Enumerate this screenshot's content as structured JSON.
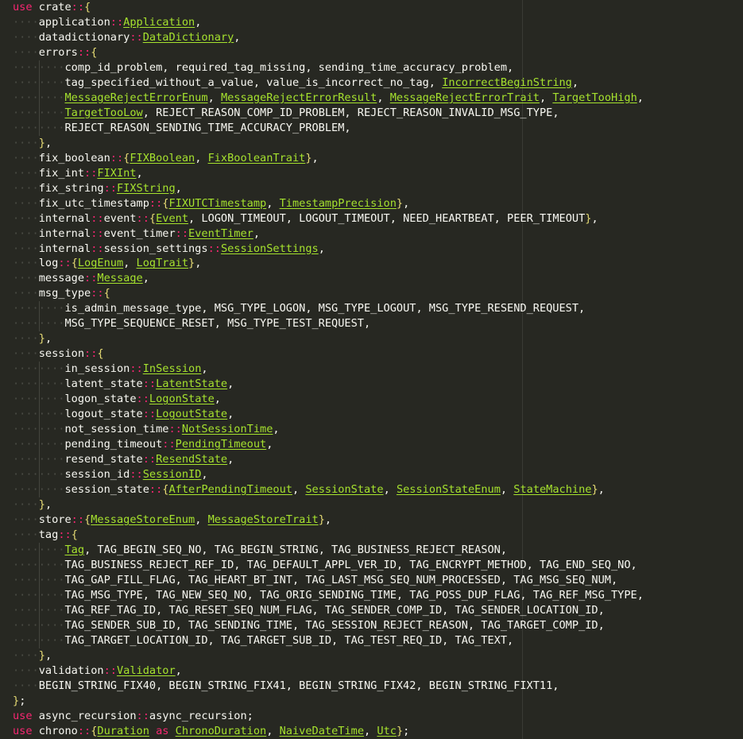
{
  "editor": {
    "language": "rust",
    "theme": "monokai",
    "colors": {
      "background": "#272822",
      "text": "#f8f8f2",
      "keyword": "#f92672",
      "type": "#a6e22e",
      "brace": "#e6db74",
      "whitespace": "#4b4c45"
    }
  },
  "lines": [
    {
      "indent": 0,
      "tokens": [
        {
          "t": "kw",
          "v": "use"
        },
        {
          "t": "tx",
          "v": " crate"
        },
        {
          "t": "op",
          "v": "::"
        },
        {
          "t": "br",
          "v": "{"
        }
      ]
    },
    {
      "indent": 1,
      "tokens": [
        {
          "t": "tx",
          "v": "application"
        },
        {
          "t": "op",
          "v": "::"
        },
        {
          "t": "ty",
          "v": "Application"
        },
        {
          "t": "tx",
          "v": ","
        }
      ]
    },
    {
      "indent": 1,
      "tokens": [
        {
          "t": "tx",
          "v": "datadictionary"
        },
        {
          "t": "op",
          "v": "::"
        },
        {
          "t": "ty",
          "v": "DataDictionary"
        },
        {
          "t": "tx",
          "v": ","
        }
      ]
    },
    {
      "indent": 1,
      "tokens": [
        {
          "t": "tx",
          "v": "errors"
        },
        {
          "t": "op",
          "v": "::"
        },
        {
          "t": "br",
          "v": "{"
        }
      ]
    },
    {
      "indent": 2,
      "tokens": [
        {
          "t": "tx",
          "v": "comp_id_problem, required_tag_missing, sending_time_accuracy_problem,"
        }
      ]
    },
    {
      "indent": 2,
      "tokens": [
        {
          "t": "tx",
          "v": "tag_specified_without_a_value, value_is_incorrect_no_tag, "
        },
        {
          "t": "ty",
          "v": "IncorrectBeginString"
        },
        {
          "t": "tx",
          "v": ","
        }
      ]
    },
    {
      "indent": 2,
      "tokens": [
        {
          "t": "ty",
          "v": "MessageRejectErrorEnum"
        },
        {
          "t": "tx",
          "v": ", "
        },
        {
          "t": "ty",
          "v": "MessageRejectErrorResult"
        },
        {
          "t": "tx",
          "v": ", "
        },
        {
          "t": "ty",
          "v": "MessageRejectErrorTrait"
        },
        {
          "t": "tx",
          "v": ", "
        },
        {
          "t": "ty",
          "v": "TargetTooHigh"
        },
        {
          "t": "tx",
          "v": ","
        }
      ]
    },
    {
      "indent": 2,
      "tokens": [
        {
          "t": "ty",
          "v": "TargetTooLow"
        },
        {
          "t": "tx",
          "v": ", REJECT_REASON_COMP_ID_PROBLEM, REJECT_REASON_INVALID_MSG_TYPE,"
        }
      ]
    },
    {
      "indent": 2,
      "tokens": [
        {
          "t": "tx",
          "v": "REJECT_REASON_SENDING_TIME_ACCURACY_PROBLEM,"
        }
      ]
    },
    {
      "indent": 1,
      "tokens": [
        {
          "t": "br",
          "v": "}"
        },
        {
          "t": "tx",
          "v": ","
        }
      ]
    },
    {
      "indent": 1,
      "tokens": [
        {
          "t": "tx",
          "v": "fix_boolean"
        },
        {
          "t": "op",
          "v": "::"
        },
        {
          "t": "br",
          "v": "{"
        },
        {
          "t": "ty",
          "v": "FIXBoolean"
        },
        {
          "t": "tx",
          "v": ", "
        },
        {
          "t": "ty",
          "v": "FixBooleanTrait"
        },
        {
          "t": "br",
          "v": "}"
        },
        {
          "t": "tx",
          "v": ","
        }
      ]
    },
    {
      "indent": 1,
      "tokens": [
        {
          "t": "tx",
          "v": "fix_int"
        },
        {
          "t": "op",
          "v": "::"
        },
        {
          "t": "ty",
          "v": "FIXInt"
        },
        {
          "t": "tx",
          "v": ","
        }
      ]
    },
    {
      "indent": 1,
      "tokens": [
        {
          "t": "tx",
          "v": "fix_string"
        },
        {
          "t": "op",
          "v": "::"
        },
        {
          "t": "ty",
          "v": "FIXString"
        },
        {
          "t": "tx",
          "v": ","
        }
      ]
    },
    {
      "indent": 1,
      "tokens": [
        {
          "t": "tx",
          "v": "fix_utc_timestamp"
        },
        {
          "t": "op",
          "v": "::"
        },
        {
          "t": "br",
          "v": "{"
        },
        {
          "t": "ty",
          "v": "FIXUTCTimestamp"
        },
        {
          "t": "tx",
          "v": ", "
        },
        {
          "t": "ty",
          "v": "TimestampPrecision"
        },
        {
          "t": "br",
          "v": "}"
        },
        {
          "t": "tx",
          "v": ","
        }
      ]
    },
    {
      "indent": 1,
      "tokens": [
        {
          "t": "tx",
          "v": "internal"
        },
        {
          "t": "op",
          "v": "::"
        },
        {
          "t": "tx",
          "v": "event"
        },
        {
          "t": "op",
          "v": "::"
        },
        {
          "t": "br",
          "v": "{"
        },
        {
          "t": "ty",
          "v": "Event"
        },
        {
          "t": "tx",
          "v": ", LOGON_TIMEOUT, LOGOUT_TIMEOUT, NEED_HEARTBEAT, PEER_TIMEOUT"
        },
        {
          "t": "br",
          "v": "}"
        },
        {
          "t": "tx",
          "v": ","
        }
      ]
    },
    {
      "indent": 1,
      "tokens": [
        {
          "t": "tx",
          "v": "internal"
        },
        {
          "t": "op",
          "v": "::"
        },
        {
          "t": "tx",
          "v": "event_timer"
        },
        {
          "t": "op",
          "v": "::"
        },
        {
          "t": "ty",
          "v": "EventTimer"
        },
        {
          "t": "tx",
          "v": ","
        }
      ]
    },
    {
      "indent": 1,
      "tokens": [
        {
          "t": "tx",
          "v": "internal"
        },
        {
          "t": "op",
          "v": "::"
        },
        {
          "t": "tx",
          "v": "session_settings"
        },
        {
          "t": "op",
          "v": "::"
        },
        {
          "t": "ty",
          "v": "SessionSettings"
        },
        {
          "t": "tx",
          "v": ","
        }
      ]
    },
    {
      "indent": 1,
      "tokens": [
        {
          "t": "tx",
          "v": "log"
        },
        {
          "t": "op",
          "v": "::"
        },
        {
          "t": "br",
          "v": "{"
        },
        {
          "t": "ty",
          "v": "LogEnum"
        },
        {
          "t": "tx",
          "v": ", "
        },
        {
          "t": "ty",
          "v": "LogTrait"
        },
        {
          "t": "br",
          "v": "}"
        },
        {
          "t": "tx",
          "v": ","
        }
      ]
    },
    {
      "indent": 1,
      "tokens": [
        {
          "t": "tx",
          "v": "message"
        },
        {
          "t": "op",
          "v": "::"
        },
        {
          "t": "ty",
          "v": "Message"
        },
        {
          "t": "tx",
          "v": ","
        }
      ]
    },
    {
      "indent": 1,
      "tokens": [
        {
          "t": "tx",
          "v": "msg_type"
        },
        {
          "t": "op",
          "v": "::"
        },
        {
          "t": "br",
          "v": "{"
        }
      ]
    },
    {
      "indent": 2,
      "tokens": [
        {
          "t": "tx",
          "v": "is_admin_message_type, MSG_TYPE_LOGON, MSG_TYPE_LOGOUT, MSG_TYPE_RESEND_REQUEST,"
        }
      ]
    },
    {
      "indent": 2,
      "tokens": [
        {
          "t": "tx",
          "v": "MSG_TYPE_SEQUENCE_RESET, MSG_TYPE_TEST_REQUEST,"
        }
      ]
    },
    {
      "indent": 1,
      "tokens": [
        {
          "t": "br",
          "v": "}"
        },
        {
          "t": "tx",
          "v": ","
        }
      ]
    },
    {
      "indent": 1,
      "tokens": [
        {
          "t": "tx",
          "v": "session"
        },
        {
          "t": "op",
          "v": "::"
        },
        {
          "t": "br",
          "v": "{"
        }
      ]
    },
    {
      "indent": 2,
      "tokens": [
        {
          "t": "tx",
          "v": "in_session"
        },
        {
          "t": "op",
          "v": "::"
        },
        {
          "t": "ty",
          "v": "InSession"
        },
        {
          "t": "tx",
          "v": ","
        }
      ]
    },
    {
      "indent": 2,
      "tokens": [
        {
          "t": "tx",
          "v": "latent_state"
        },
        {
          "t": "op",
          "v": "::"
        },
        {
          "t": "ty",
          "v": "LatentState"
        },
        {
          "t": "tx",
          "v": ","
        }
      ]
    },
    {
      "indent": 2,
      "tokens": [
        {
          "t": "tx",
          "v": "logon_state"
        },
        {
          "t": "op",
          "v": "::"
        },
        {
          "t": "ty",
          "v": "LogonState"
        },
        {
          "t": "tx",
          "v": ","
        }
      ]
    },
    {
      "indent": 2,
      "tokens": [
        {
          "t": "tx",
          "v": "logout_state"
        },
        {
          "t": "op",
          "v": "::"
        },
        {
          "t": "ty",
          "v": "LogoutState"
        },
        {
          "t": "tx",
          "v": ","
        }
      ]
    },
    {
      "indent": 2,
      "tokens": [
        {
          "t": "tx",
          "v": "not_session_time"
        },
        {
          "t": "op",
          "v": "::"
        },
        {
          "t": "ty",
          "v": "NotSessionTime"
        },
        {
          "t": "tx",
          "v": ","
        }
      ]
    },
    {
      "indent": 2,
      "tokens": [
        {
          "t": "tx",
          "v": "pending_timeout"
        },
        {
          "t": "op",
          "v": "::"
        },
        {
          "t": "ty",
          "v": "PendingTimeout"
        },
        {
          "t": "tx",
          "v": ","
        }
      ]
    },
    {
      "indent": 2,
      "tokens": [
        {
          "t": "tx",
          "v": "resend_state"
        },
        {
          "t": "op",
          "v": "::"
        },
        {
          "t": "ty",
          "v": "ResendState"
        },
        {
          "t": "tx",
          "v": ","
        }
      ]
    },
    {
      "indent": 2,
      "tokens": [
        {
          "t": "tx",
          "v": "session_id"
        },
        {
          "t": "op",
          "v": "::"
        },
        {
          "t": "ty",
          "v": "SessionID"
        },
        {
          "t": "tx",
          "v": ","
        }
      ]
    },
    {
      "indent": 2,
      "tokens": [
        {
          "t": "tx",
          "v": "session_state"
        },
        {
          "t": "op",
          "v": "::"
        },
        {
          "t": "br",
          "v": "{"
        },
        {
          "t": "ty",
          "v": "AfterPendingTimeout"
        },
        {
          "t": "tx",
          "v": ", "
        },
        {
          "t": "ty",
          "v": "SessionState"
        },
        {
          "t": "tx",
          "v": ", "
        },
        {
          "t": "ty",
          "v": "SessionStateEnum"
        },
        {
          "t": "tx",
          "v": ", "
        },
        {
          "t": "ty",
          "v": "StateMachine"
        },
        {
          "t": "br",
          "v": "}"
        },
        {
          "t": "tx",
          "v": ","
        }
      ]
    },
    {
      "indent": 1,
      "tokens": [
        {
          "t": "br",
          "v": "}"
        },
        {
          "t": "tx",
          "v": ","
        }
      ]
    },
    {
      "indent": 1,
      "tokens": [
        {
          "t": "tx",
          "v": "store"
        },
        {
          "t": "op",
          "v": "::"
        },
        {
          "t": "br",
          "v": "{"
        },
        {
          "t": "ty",
          "v": "MessageStoreEnum"
        },
        {
          "t": "tx",
          "v": ", "
        },
        {
          "t": "ty",
          "v": "MessageStoreTrait"
        },
        {
          "t": "br",
          "v": "}"
        },
        {
          "t": "tx",
          "v": ","
        }
      ]
    },
    {
      "indent": 1,
      "tokens": [
        {
          "t": "tx",
          "v": "tag"
        },
        {
          "t": "op",
          "v": "::"
        },
        {
          "t": "br",
          "v": "{"
        }
      ]
    },
    {
      "indent": 2,
      "tokens": [
        {
          "t": "ty",
          "v": "Tag"
        },
        {
          "t": "tx",
          "v": ", TAG_BEGIN_SEQ_NO, TAG_BEGIN_STRING, TAG_BUSINESS_REJECT_REASON,"
        }
      ]
    },
    {
      "indent": 2,
      "tokens": [
        {
          "t": "tx",
          "v": "TAG_BUSINESS_REJECT_REF_ID, TAG_DEFAULT_APPL_VER_ID, TAG_ENCRYPT_METHOD, TAG_END_SEQ_NO,"
        }
      ]
    },
    {
      "indent": 2,
      "tokens": [
        {
          "t": "tx",
          "v": "TAG_GAP_FILL_FLAG, TAG_HEART_BT_INT, TAG_LAST_MSG_SEQ_NUM_PROCESSED, TAG_MSG_SEQ_NUM,"
        }
      ]
    },
    {
      "indent": 2,
      "tokens": [
        {
          "t": "tx",
          "v": "TAG_MSG_TYPE, TAG_NEW_SEQ_NO, TAG_ORIG_SENDING_TIME, TAG_POSS_DUP_FLAG, TAG_REF_MSG_TYPE,"
        }
      ]
    },
    {
      "indent": 2,
      "tokens": [
        {
          "t": "tx",
          "v": "TAG_REF_TAG_ID, TAG_RESET_SEQ_NUM_FLAG, TAG_SENDER_COMP_ID, TAG_SENDER_LOCATION_ID,"
        }
      ]
    },
    {
      "indent": 2,
      "tokens": [
        {
          "t": "tx",
          "v": "TAG_SENDER_SUB_ID, TAG_SENDING_TIME, TAG_SESSION_REJECT_REASON, TAG_TARGET_COMP_ID,"
        }
      ]
    },
    {
      "indent": 2,
      "tokens": [
        {
          "t": "tx",
          "v": "TAG_TARGET_LOCATION_ID, TAG_TARGET_SUB_ID, TAG_TEST_REQ_ID, TAG_TEXT,"
        }
      ]
    },
    {
      "indent": 1,
      "tokens": [
        {
          "t": "br",
          "v": "}"
        },
        {
          "t": "tx",
          "v": ","
        }
      ]
    },
    {
      "indent": 1,
      "tokens": [
        {
          "t": "tx",
          "v": "validation"
        },
        {
          "t": "op",
          "v": "::"
        },
        {
          "t": "ty",
          "v": "Validator"
        },
        {
          "t": "tx",
          "v": ","
        }
      ]
    },
    {
      "indent": 1,
      "tokens": [
        {
          "t": "tx",
          "v": "BEGIN_STRING_FIX40, BEGIN_STRING_FIX41, BEGIN_STRING_FIX42, BEGIN_STRING_FIXT11,"
        }
      ]
    },
    {
      "indent": 0,
      "tokens": [
        {
          "t": "br",
          "v": "}"
        },
        {
          "t": "tx",
          "v": ";"
        }
      ]
    },
    {
      "indent": 0,
      "tokens": [
        {
          "t": "kw",
          "v": "use"
        },
        {
          "t": "tx",
          "v": " async_recursion"
        },
        {
          "t": "op",
          "v": "::"
        },
        {
          "t": "tx",
          "v": "async_recursion;"
        }
      ]
    },
    {
      "indent": 0,
      "tokens": [
        {
          "t": "kw",
          "v": "use"
        },
        {
          "t": "tx",
          "v": " chrono"
        },
        {
          "t": "op",
          "v": "::"
        },
        {
          "t": "br",
          "v": "{"
        },
        {
          "t": "ty",
          "v": "Duration"
        },
        {
          "t": "tx",
          "v": " "
        },
        {
          "t": "kw",
          "v": "as"
        },
        {
          "t": "tx",
          "v": " "
        },
        {
          "t": "ty",
          "v": "ChronoDuration"
        },
        {
          "t": "tx",
          "v": ", "
        },
        {
          "t": "ty",
          "v": "NaiveDateTime"
        },
        {
          "t": "tx",
          "v": ", "
        },
        {
          "t": "ty",
          "v": "Utc"
        },
        {
          "t": "br",
          "v": "}"
        },
        {
          "t": "tx",
          "v": ";"
        }
      ]
    }
  ]
}
